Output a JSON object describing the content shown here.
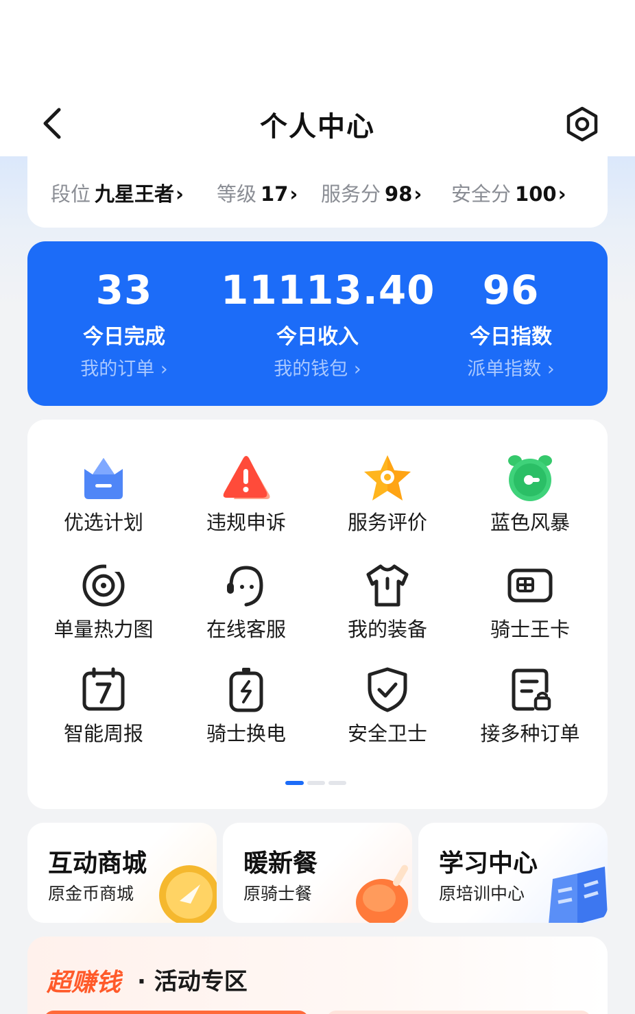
{
  "header": {
    "title": "个人中心",
    "back_icon": "chevron-left-icon",
    "settings_icon": "hexagon-settings-icon"
  },
  "rank": {
    "items": [
      {
        "label": "段位",
        "value": "九星王者",
        "chevron": "›"
      },
      {
        "label": "等级",
        "value": "17",
        "chevron": "›"
      },
      {
        "label": "服务分",
        "value": "98",
        "chevron": "›"
      },
      {
        "label": "安全分",
        "value": "100",
        "chevron": "›"
      }
    ]
  },
  "stats": {
    "color": "#1c6cf8",
    "items": [
      {
        "number": "33",
        "label": "今日完成",
        "link": "我的订单 ›"
      },
      {
        "number": "11113.40",
        "label": "今日收入",
        "link": "我的钱包 ›"
      },
      {
        "number": "96",
        "label": "今日指数",
        "link": "派单指数 ›"
      }
    ]
  },
  "grid": {
    "items": [
      {
        "label": "优选计划",
        "icon": "crown-icon"
      },
      {
        "label": "违规申诉",
        "icon": "warning-icon"
      },
      {
        "label": "服务评价",
        "icon": "star-icon"
      },
      {
        "label": "蓝色风暴",
        "icon": "alarm-clock-icon"
      },
      {
        "label": "单量热力图",
        "icon": "target-icon"
      },
      {
        "label": "在线客服",
        "icon": "headset-icon"
      },
      {
        "label": "我的装备",
        "icon": "shirt-icon"
      },
      {
        "label": "骑士王卡",
        "icon": "card-icon"
      },
      {
        "label": "智能周报",
        "icon": "calendar-icon"
      },
      {
        "label": "骑士换电",
        "icon": "battery-icon"
      },
      {
        "label": "安全卫士",
        "icon": "shield-icon"
      },
      {
        "label": "接多种订单",
        "icon": "document-icon"
      }
    ],
    "pager": {
      "pages": 3,
      "active": 1
    }
  },
  "tiles": [
    {
      "title": "互动商城",
      "subtitle": "原金币商城",
      "icon": "coin-icon"
    },
    {
      "title": "暖新餐",
      "subtitle": "原骑士餐",
      "icon": "chicken-leg-icon"
    },
    {
      "title": "学习中心",
      "subtitle": "原培训中心",
      "icon": "book-icon"
    }
  ],
  "promo": {
    "brand": "超赚钱",
    "title": "· 活动专区"
  }
}
